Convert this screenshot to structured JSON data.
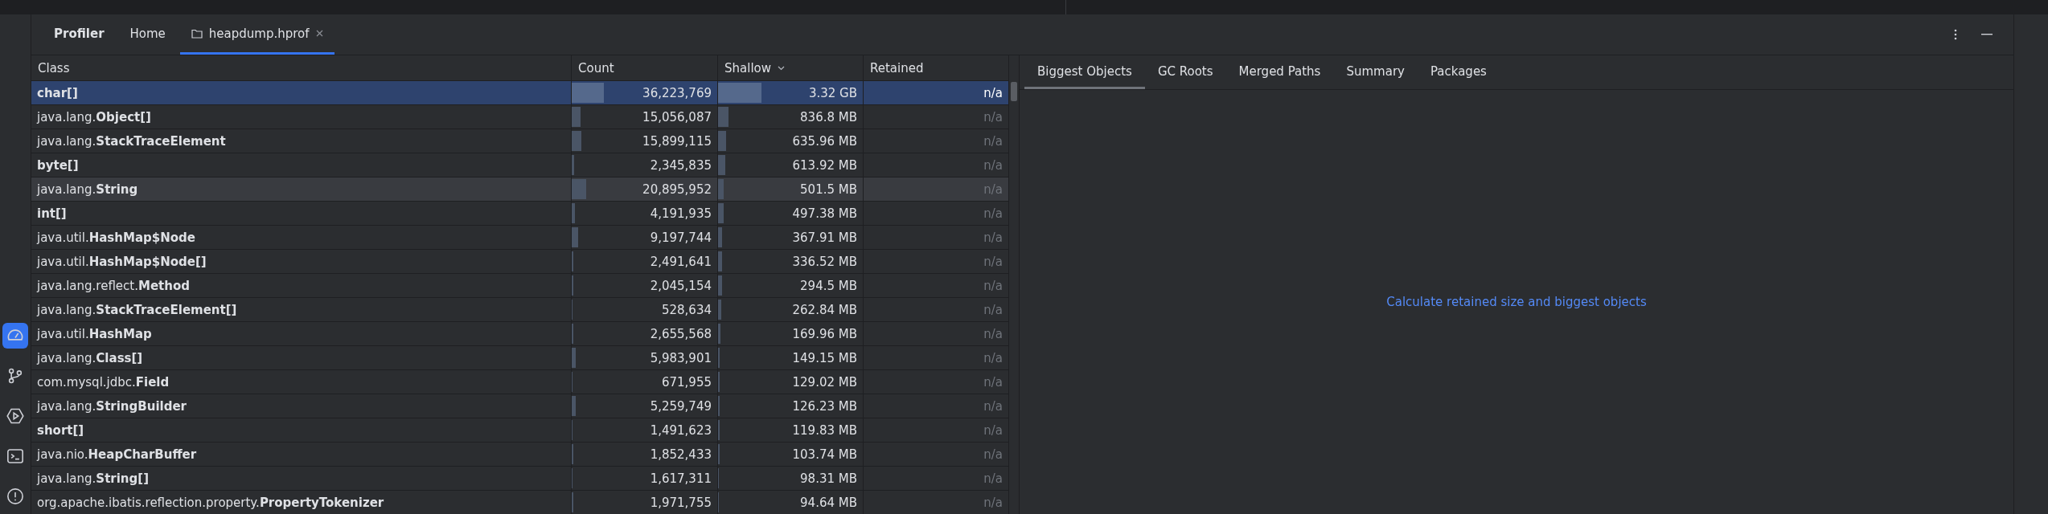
{
  "tabs": [
    {
      "label": "Profiler",
      "kind": "title",
      "selected": false
    },
    {
      "label": "Home",
      "kind": "plain",
      "selected": false
    },
    {
      "label": "heapdump.hprof",
      "kind": "file",
      "selected": true,
      "closable": true
    }
  ],
  "sidebar": {
    "items": [
      {
        "kind": "gauge",
        "selected": true
      },
      {
        "kind": "branch",
        "selected": false
      },
      {
        "kind": "run",
        "selected": false
      },
      {
        "kind": "terminal",
        "selected": false
      },
      {
        "kind": "alert",
        "selected": false
      }
    ]
  },
  "table": {
    "columns": [
      {
        "label": "Class",
        "sorted": false
      },
      {
        "label": "Count",
        "sorted": false
      },
      {
        "label": "Shallow",
        "sorted": true
      },
      {
        "label": "Retained",
        "sorted": false
      }
    ],
    "rows": [
      {
        "class": "**char[]**",
        "count": {
          "value": "36,223,769",
          "level": 0.22
        },
        "shallow": {
          "value": "3.32 GB",
          "level": 0.3
        },
        "retained": "n/a",
        "selected": true,
        "hovered": false
      },
      {
        "class": "java.lang.**Object[]**",
        "count": {
          "value": "15,056,087",
          "level": 0.06
        },
        "shallow": {
          "value": "836.8 MB",
          "level": 0.07
        },
        "retained": "n/a",
        "selected": false,
        "hovered": false
      },
      {
        "class": "java.lang.**StackTraceElement**",
        "count": {
          "value": "15,899,115",
          "level": 0.065
        },
        "shallow": {
          "value": "635.96 MB",
          "level": 0.055
        },
        "retained": "n/a",
        "selected": false,
        "hovered": false
      },
      {
        "class": "**byte[]**",
        "count": {
          "value": "2,345,835",
          "level": 0.015
        },
        "shallow": {
          "value": "613.92 MB",
          "level": 0.05
        },
        "retained": "n/a",
        "selected": false,
        "hovered": false
      },
      {
        "class": "java.lang.**String**",
        "count": {
          "value": "20,895,952",
          "level": 0.1
        },
        "shallow": {
          "value": "501.5 MB",
          "level": 0.04
        },
        "retained": "n/a",
        "selected": false,
        "hovered": true
      },
      {
        "class": "**int[]**",
        "count": {
          "value": "4,191,935",
          "level": 0.02
        },
        "shallow": {
          "value": "497.38 MB",
          "level": 0.04
        },
        "retained": "n/a",
        "selected": false,
        "hovered": false
      },
      {
        "class": "java.util.**HashMap$Node**",
        "count": {
          "value": "9,197,744",
          "level": 0.045
        },
        "shallow": {
          "value": "367.91 MB",
          "level": 0.03
        },
        "retained": "n/a",
        "selected": false,
        "hovered": false
      },
      {
        "class": "java.util.**HashMap$Node[]**",
        "count": {
          "value": "2,491,641",
          "level": 0.012
        },
        "shallow": {
          "value": "336.52 MB",
          "level": 0.028
        },
        "retained": "n/a",
        "selected": false,
        "hovered": false
      },
      {
        "class": "java.lang.reflect.**Method**",
        "count": {
          "value": "2,045,154",
          "level": 0.01
        },
        "shallow": {
          "value": "294.5 MB",
          "level": 0.025
        },
        "retained": "n/a",
        "selected": false,
        "hovered": false
      },
      {
        "class": "java.lang.**StackTraceElement[]**",
        "count": {
          "value": "528,634",
          "level": 0.004
        },
        "shallow": {
          "value": "262.84 MB",
          "level": 0.022
        },
        "retained": "n/a",
        "selected": false,
        "hovered": false
      },
      {
        "class": "java.util.**HashMap**",
        "count": {
          "value": "2,655,568",
          "level": 0.013
        },
        "shallow": {
          "value": "169.96 MB",
          "level": 0.014
        },
        "retained": "n/a",
        "selected": false,
        "hovered": false
      },
      {
        "class": "java.lang.**Class[]**",
        "count": {
          "value": "5,983,901",
          "level": 0.028
        },
        "shallow": {
          "value": "149.15 MB",
          "level": 0.012
        },
        "retained": "n/a",
        "selected": false,
        "hovered": false
      },
      {
        "class": "com.mysql.jdbc.**Field**",
        "count": {
          "value": "671,955",
          "level": 0.004
        },
        "shallow": {
          "value": "129.02 MB",
          "level": 0.011
        },
        "retained": "n/a",
        "selected": false,
        "hovered": false
      },
      {
        "class": "java.lang.**StringBuilder**",
        "count": {
          "value": "5,259,749",
          "level": 0.025
        },
        "shallow": {
          "value": "126.23 MB",
          "level": 0.011
        },
        "retained": "n/a",
        "selected": false,
        "hovered": false
      },
      {
        "class": "**short[]**",
        "count": {
          "value": "1,491,623",
          "level": 0.007
        },
        "shallow": {
          "value": "119.83 MB",
          "level": 0.01
        },
        "retained": "n/a",
        "selected": false,
        "hovered": false
      },
      {
        "class": "java.nio.**HeapCharBuffer**",
        "count": {
          "value": "1,852,433",
          "level": 0.009
        },
        "shallow": {
          "value": "103.74 MB",
          "level": 0.009
        },
        "retained": "n/a",
        "selected": false,
        "hovered": false
      },
      {
        "class": "java.lang.**String[]**",
        "count": {
          "value": "1,617,311",
          "level": 0.008
        },
        "shallow": {
          "value": "98.31 MB",
          "level": 0.008
        },
        "retained": "n/a",
        "selected": false,
        "hovered": false
      },
      {
        "class": "org.apache.ibatis.reflection.property.**PropertyTokenizer**",
        "count": {
          "value": "1,971,755",
          "level": 0.009
        },
        "shallow": {
          "value": "94.64 MB",
          "level": 0.008
        },
        "retained": "n/a",
        "selected": false,
        "hovered": false
      }
    ]
  },
  "detail": {
    "tabs": [
      {
        "label": "Biggest Objects",
        "selected": true
      },
      {
        "label": "GC Roots",
        "selected": false
      },
      {
        "label": "Merged Paths",
        "selected": false
      },
      {
        "label": "Summary",
        "selected": false
      },
      {
        "label": "Packages",
        "selected": false
      }
    ],
    "link": "Calculate retained size and biggest objects"
  }
}
